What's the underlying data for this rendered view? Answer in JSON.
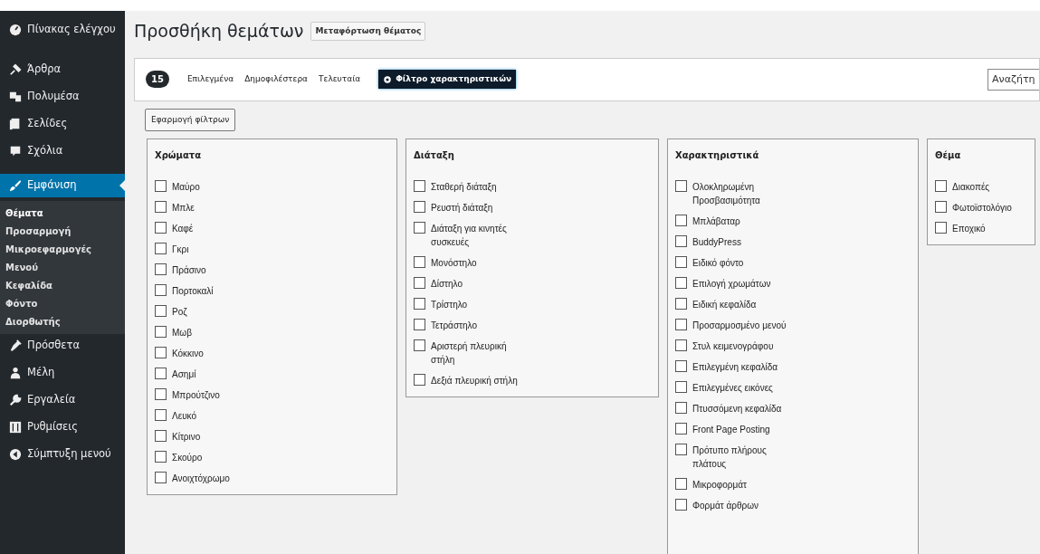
{
  "sidebar": {
    "items": [
      {
        "label": "Πίνακας ελέγχου",
        "selected": false
      },
      {
        "label": "Άρθρα",
        "selected": false
      },
      {
        "label": "Πολυμέσα",
        "selected": false
      },
      {
        "label": "Σελίδες",
        "selected": false
      },
      {
        "label": "Σχόλια",
        "selected": false
      },
      {
        "label": "Εμφάνιση",
        "selected": true,
        "children": [
          {
            "label": "Θέματα",
            "selected": true
          },
          {
            "label": "Προσαρμογή",
            "selected": false
          },
          {
            "label": "Μικροεφαρμογές",
            "selected": false
          },
          {
            "label": "Μενού",
            "selected": false
          },
          {
            "label": "Κεφαλίδα",
            "selected": false
          },
          {
            "label": "Φόντο",
            "selected": false
          },
          {
            "label": "Διορθωτής",
            "selected": false
          }
        ]
      },
      {
        "label": "Πρόσθετα",
        "selected": false
      },
      {
        "label": "Μέλη",
        "selected": false
      },
      {
        "label": "Εργαλεία",
        "selected": false
      },
      {
        "label": "Ρυθμίσεις",
        "selected": false
      },
      {
        "label": "Σύμπτυξη μενού",
        "selected": false
      }
    ]
  },
  "page": {
    "title": "Προσθήκη θεμάτων",
    "upload_button": "Μεταφόρτωση θέματος"
  },
  "filter_bar": {
    "count": "15",
    "tabs": [
      {
        "label": "Επιλεγμένα",
        "selected": false
      },
      {
        "label": "Δημοφιλέστερα",
        "selected": false
      },
      {
        "label": "Τελευταία",
        "selected": false
      },
      {
        "label": "Φίλτρο χαρακτηριστικών",
        "selected": true
      }
    ],
    "search": {
      "placeholder": "Αναζήτη"
    }
  },
  "apply_button": "Εφαρμογή φίλτρων",
  "filter_groups": [
    {
      "title": "Χρώματα",
      "options": [
        {
          "label": "Μαύρο",
          "checked": false
        },
        {
          "label": "Μπλε",
          "checked": false
        },
        {
          "label": "Καφέ",
          "checked": false
        },
        {
          "label": "Γκρι",
          "checked": false
        },
        {
          "label": "Πράσινο",
          "checked": false
        },
        {
          "label": "Πορτοκαλί",
          "checked": false
        },
        {
          "label": "Ροζ",
          "checked": false
        },
        {
          "label": "Μωβ",
          "checked": false
        },
        {
          "label": "Κόκκινο",
          "checked": false
        },
        {
          "label": "Ασημί",
          "checked": false
        },
        {
          "label": "Μπρούτζινο",
          "checked": false
        },
        {
          "label": "Λευκό",
          "checked": false
        },
        {
          "label": "Κίτρινο",
          "checked": false
        },
        {
          "label": "Σκούρο",
          "checked": false
        },
        {
          "label": "Ανοιχτόχρωμο",
          "checked": false
        }
      ]
    },
    {
      "title": "Διάταξη",
      "options": [
        {
          "label": "Σταθερή διάταξη",
          "checked": false
        },
        {
          "label": "Ρευστή διάταξη",
          "checked": false
        },
        {
          "label": "Διάταξη για κινητές συσκευές",
          "checked": false
        },
        {
          "label": "Μονόστηλο",
          "checked": false
        },
        {
          "label": "Δίστηλο",
          "checked": false
        },
        {
          "label": "Τρίστηλο",
          "checked": false
        },
        {
          "label": "Τετράστηλο",
          "checked": false
        },
        {
          "label": "Αριστερή πλευρική στήλη",
          "checked": false
        },
        {
          "label": "Δεξιά πλευρική στήλη",
          "checked": false
        }
      ]
    },
    {
      "title": "Χαρακτηριστικά",
      "options": [
        {
          "label": "Ολοκληρωμένη Προσβασιμότητα",
          "checked": false
        },
        {
          "label": "Μπλάβαταρ",
          "checked": false
        },
        {
          "label": "BuddyPress",
          "checked": false
        },
        {
          "label": "Ειδικό φόντο",
          "checked": false
        },
        {
          "label": "Επιλογή χρωμάτων",
          "checked": false
        },
        {
          "label": "Ειδική κεφαλίδα",
          "checked": false
        },
        {
          "label": "Προσαρμοσμένο μενού",
          "checked": false
        },
        {
          "label": "Στυλ κειμενογράφου",
          "checked": false
        },
        {
          "label": "Επιλεγμένη κεφαλίδα",
          "checked": false
        },
        {
          "label": "Επιλεγμένες εικόνες",
          "checked": false
        },
        {
          "label": "Πτυσσόμενη κεφαλίδα",
          "checked": false
        },
        {
          "label": "Front Page Posting",
          "checked": false
        },
        {
          "label": "Πρότυπο πλήρους πλάτους",
          "checked": false
        },
        {
          "label": "Μικροφορμάτ",
          "checked": false
        },
        {
          "label": "Φορμάτ άρθρων",
          "checked": false
        }
      ]
    },
    {
      "title": "Θέμα",
      "options": [
        {
          "label": "Διακοπές",
          "checked": false
        },
        {
          "label": "Φωτοϊστολόγιο",
          "checked": false
        },
        {
          "label": "Εποχικό",
          "checked": false
        }
      ]
    }
  ]
}
